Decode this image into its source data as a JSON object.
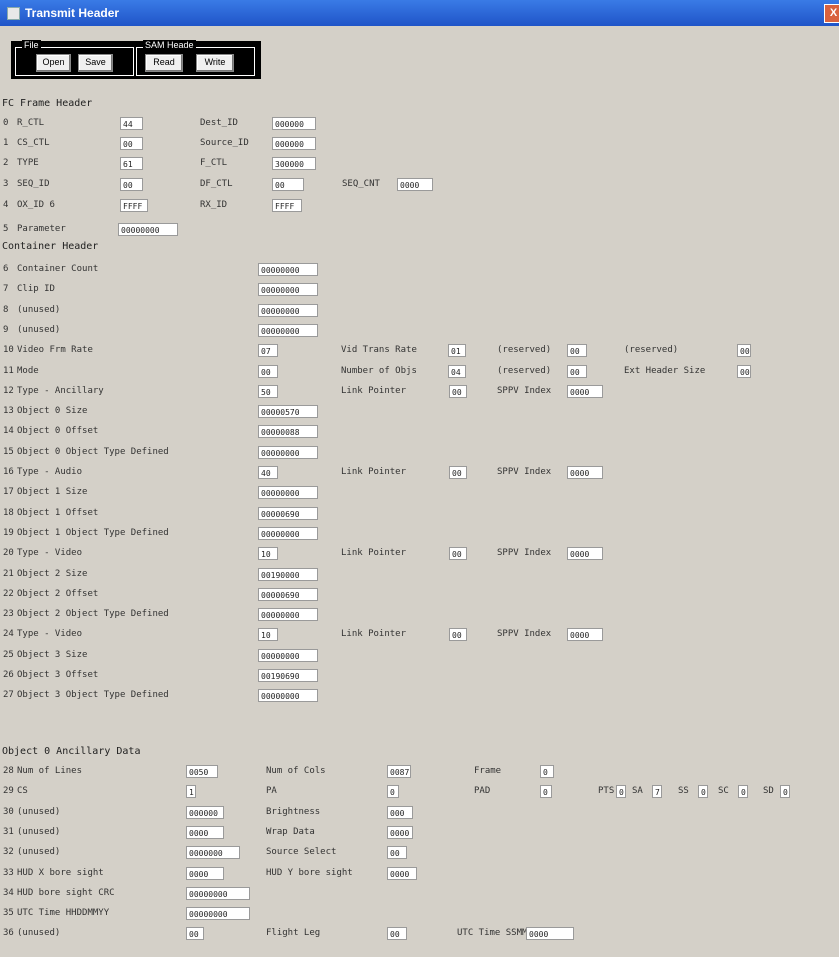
{
  "window": {
    "title": "Transmit Header",
    "close": "X"
  },
  "toolbar": {
    "file_label": "File",
    "sam_label": "SAM Heade",
    "open": "Open",
    "save": "Save",
    "read": "Read",
    "write": "Write"
  },
  "sections": {
    "fc": "FC Frame Header",
    "container": "Container Header",
    "ancillary": "Object 0 Ancillary Data"
  },
  "rows": [
    {
      "n": "0",
      "fields": [
        {
          "label": "R_CTL",
          "value": "44"
        },
        {
          "label": "Dest_ID",
          "value": "000000"
        }
      ]
    },
    {
      "n": "1",
      "fields": [
        {
          "label": "CS_CTL",
          "value": "00"
        },
        {
          "label": "Source_ID",
          "value": "000000"
        }
      ]
    },
    {
      "n": "2",
      "fields": [
        {
          "label": "TYPE",
          "value": "61"
        },
        {
          "label": "F_CTL",
          "value": "300000"
        }
      ]
    },
    {
      "n": "3",
      "fields": [
        {
          "label": "SEQ_ID",
          "value": "00"
        },
        {
          "label": "DF_CTL",
          "value": "00"
        },
        {
          "label": "SEQ_CNT",
          "value": "0000"
        }
      ]
    },
    {
      "n": "4",
      "fields": [
        {
          "label": "OX_ID 6",
          "value": "FFFF"
        },
        {
          "label": "RX_ID",
          "value": "FFFF"
        }
      ]
    },
    {
      "n": "5",
      "fields": [
        {
          "label": "Parameter",
          "value": "00000000"
        }
      ]
    },
    {
      "n": "6",
      "fields": [
        {
          "label": "Container Count",
          "value": "00000000"
        }
      ]
    },
    {
      "n": "7",
      "fields": [
        {
          "label": "Clip ID",
          "value": "00000000"
        }
      ]
    },
    {
      "n": "8",
      "fields": [
        {
          "label": "(unused)",
          "value": "00000000"
        }
      ]
    },
    {
      "n": "9",
      "fields": [
        {
          "label": "(unused)",
          "value": "00000000"
        }
      ]
    },
    {
      "n": "10",
      "fields": [
        {
          "label": "Video Frm Rate",
          "value": "07"
        },
        {
          "label": "Vid Trans Rate",
          "value": "01"
        },
        {
          "label": "(reserved)",
          "value": "00"
        },
        {
          "label": "(reserved)",
          "value": "00"
        }
      ]
    },
    {
      "n": "11",
      "fields": [
        {
          "label": "Mode",
          "value": "00"
        },
        {
          "label": "Number of Objs",
          "value": "04"
        },
        {
          "label": "(reserved)",
          "value": "00"
        },
        {
          "label": "Ext Header Size",
          "value": "00"
        }
      ]
    },
    {
      "n": "12",
      "fields": [
        {
          "label": "Type - Ancillary",
          "value": "50"
        },
        {
          "label": "Link Pointer",
          "value": "00"
        },
        {
          "label": "SPPV Index",
          "value": "0000"
        }
      ]
    },
    {
      "n": "13",
      "fields": [
        {
          "label": "Object 0 Size",
          "value": "00000570"
        }
      ]
    },
    {
      "n": "14",
      "fields": [
        {
          "label": "Object 0 Offset",
          "value": "00000088"
        }
      ]
    },
    {
      "n": "15",
      "fields": [
        {
          "label": "Object 0 Object Type Defined",
          "value": "00000000"
        }
      ]
    },
    {
      "n": "16",
      "fields": [
        {
          "label": "Type - Audio",
          "value": "40"
        },
        {
          "label": "Link Pointer",
          "value": "00"
        },
        {
          "label": "SPPV Index",
          "value": "0000"
        }
      ]
    },
    {
      "n": "17",
      "fields": [
        {
          "label": "Object 1 Size",
          "value": "00000000"
        }
      ]
    },
    {
      "n": "18",
      "fields": [
        {
          "label": "Object 1 Offset",
          "value": "00000690"
        }
      ]
    },
    {
      "n": "19",
      "fields": [
        {
          "label": "Object 1 Object Type Defined",
          "value": "00000000"
        }
      ]
    },
    {
      "n": "20",
      "fields": [
        {
          "label": "Type - Video",
          "value": "10"
        },
        {
          "label": "Link Pointer",
          "value": "00"
        },
        {
          "label": "SPPV Index",
          "value": "0000"
        }
      ]
    },
    {
      "n": "21",
      "fields": [
        {
          "label": "Object 2 Size",
          "value": "00190000"
        }
      ]
    },
    {
      "n": "22",
      "fields": [
        {
          "label": "Object 2 Offset",
          "value": "00000690"
        }
      ]
    },
    {
      "n": "23",
      "fields": [
        {
          "label": "Object 2 Object Type Defined",
          "value": "00000000"
        }
      ]
    },
    {
      "n": "24",
      "fields": [
        {
          "label": "Type - Video",
          "value": "10"
        },
        {
          "label": "Link Pointer",
          "value": "00"
        },
        {
          "label": "SPPV Index",
          "value": "0000"
        }
      ]
    },
    {
      "n": "25",
      "fields": [
        {
          "label": "Object 3 Size",
          "value": "00000000"
        }
      ]
    },
    {
      "n": "26",
      "fields": [
        {
          "label": "Object 3 Offset",
          "value": "00190690"
        }
      ]
    },
    {
      "n": "27",
      "fields": [
        {
          "label": "Object 3 Object Type Defined",
          "value": "00000000"
        }
      ]
    },
    {
      "n": "28",
      "fields": [
        {
          "label": "Num of Lines",
          "value": "0050"
        },
        {
          "label": "Num of Cols",
          "value": "0087"
        },
        {
          "label": "Frame",
          "value": "0"
        }
      ]
    },
    {
      "n": "29",
      "fields": [
        {
          "label": "CS",
          "value": "1"
        },
        {
          "label": "PA",
          "value": "0"
        },
        {
          "label": "PAD",
          "value": "0"
        },
        {
          "label": "PTS",
          "value": "0"
        },
        {
          "label": "SA",
          "value": "7"
        },
        {
          "label": "SS",
          "value": "0"
        },
        {
          "label": "SC",
          "value": "0"
        },
        {
          "label": "SD",
          "value": "0"
        }
      ]
    },
    {
      "n": "30",
      "fields": [
        {
          "label": "(unused)",
          "value": "000000"
        },
        {
          "label": "Brightness",
          "value": "000"
        }
      ]
    },
    {
      "n": "31",
      "fields": [
        {
          "label": "(unused)",
          "value": "0000"
        },
        {
          "label": "Wrap Data",
          "value": "0000"
        }
      ]
    },
    {
      "n": "32",
      "fields": [
        {
          "label": "(unused)",
          "value": "0000000"
        },
        {
          "label": "Source Select",
          "value": "00"
        }
      ]
    },
    {
      "n": "33",
      "fields": [
        {
          "label": "HUD X bore sight",
          "value": "0000"
        },
        {
          "label": "HUD Y bore sight",
          "value": "0000"
        }
      ]
    },
    {
      "n": "34",
      "fields": [
        {
          "label": "HUD bore sight CRC",
          "value": "00000000"
        }
      ]
    },
    {
      "n": "35",
      "fields": [
        {
          "label": "UTC Time HHDDMMYY",
          "value": "00000000"
        }
      ]
    },
    {
      "n": "36",
      "fields": [
        {
          "label": "(unused)",
          "value": "00"
        },
        {
          "label": "Flight Leg",
          "value": "00"
        },
        {
          "label": "UTC Time SSMM",
          "value": "0000"
        }
      ]
    }
  ]
}
